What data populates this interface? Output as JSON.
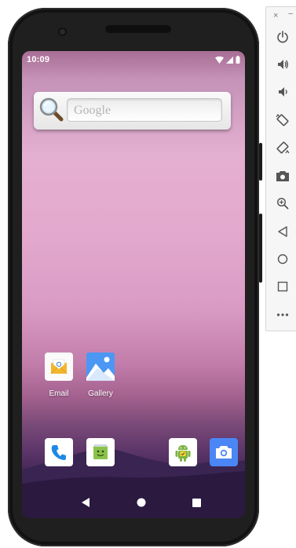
{
  "status_bar": {
    "time": "10:09"
  },
  "search": {
    "placeholder": "Google"
  },
  "apps": [
    {
      "label": "Email"
    },
    {
      "label": "Gallery"
    }
  ],
  "dock": [
    {
      "name": "Phone"
    },
    {
      "name": "Messages"
    },
    {
      "name": "Android"
    },
    {
      "name": "Camera"
    }
  ],
  "emulator": {
    "close_label": "×",
    "minimize_label": "−",
    "buttons": [
      "power",
      "volume-up",
      "volume-down",
      "rotate-left",
      "rotate-right",
      "screenshot",
      "zoom",
      "back",
      "home",
      "overview",
      "more"
    ]
  },
  "colors": {
    "phone_frame": "#1f1f1f",
    "accent_blue": "#1e88e5",
    "camera_blue": "#4a86f5"
  }
}
